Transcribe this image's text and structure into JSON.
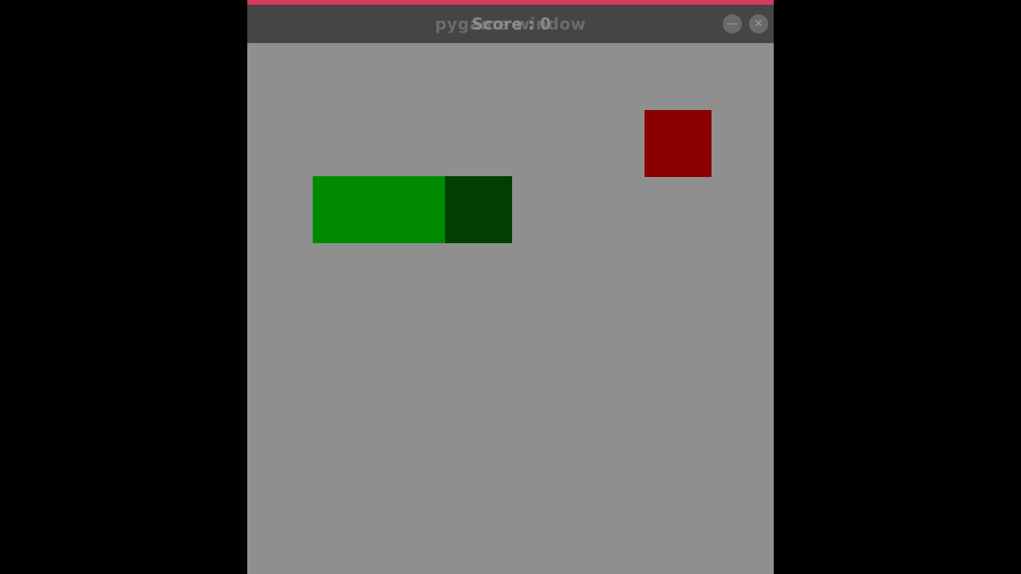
{
  "window": {
    "title_behind": "pygame window",
    "title": "Score : 0",
    "minimize_glyph": "—",
    "close_glyph": "✕"
  },
  "game": {
    "snake_body_color": "#008a00",
    "snake_head_color": "#003f00",
    "food_color": "#8a0000",
    "background_color": "#8f8f8f",
    "accent_color": "#d43a5c"
  }
}
